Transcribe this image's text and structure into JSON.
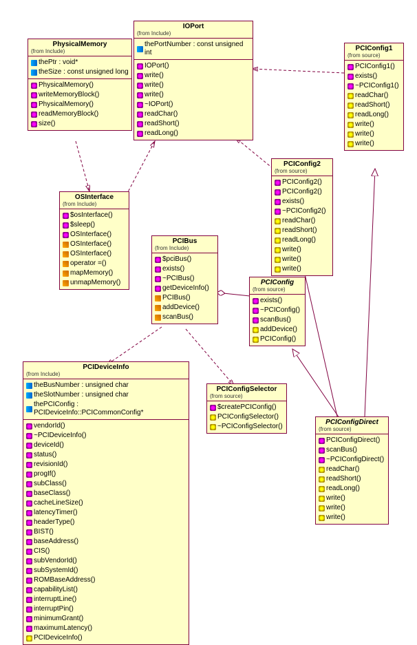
{
  "classes": {
    "PhysicalMemory": {
      "name": "PhysicalMemory",
      "from": "(from Include)",
      "attrs": [
        {
          "v": "attr",
          "t": "thePtr : void*"
        },
        {
          "v": "attr",
          "t": "theSize : const unsigned long"
        }
      ],
      "ops": [
        {
          "v": "pub",
          "t": "PhysicalMemory()"
        },
        {
          "v": "pub",
          "t": "writeMemoryBlock()"
        },
        {
          "v": "pub",
          "t": "PhysicalMemory()"
        },
        {
          "v": "pub",
          "t": "readMemoryBlock()"
        },
        {
          "v": "pub",
          "t": "size()"
        }
      ]
    },
    "IOPort": {
      "name": "IOPort",
      "from": "(from Include)",
      "attrs": [
        {
          "v": "attr",
          "t": "thePortNumber : const unsigned int"
        }
      ],
      "ops": [
        {
          "v": "pub",
          "t": "IOPort()"
        },
        {
          "v": "pub",
          "t": "write()"
        },
        {
          "v": "pub",
          "t": "write()"
        },
        {
          "v": "pub",
          "t": "write()"
        },
        {
          "v": "pub",
          "t": "~IOPort()"
        },
        {
          "v": "pub",
          "t": "readChar()"
        },
        {
          "v": "pub",
          "t": "readShort()"
        },
        {
          "v": "pub",
          "t": "readLong()"
        }
      ]
    },
    "PCIConfig1": {
      "name": "PCIConfig1",
      "from": "(from source)",
      "ops": [
        {
          "v": "pub",
          "t": "PCIConfig1()"
        },
        {
          "v": "pub",
          "t": "exists()"
        },
        {
          "v": "pub",
          "t": "~PCIConfig1()"
        },
        {
          "v": "prot",
          "t": "readChar()"
        },
        {
          "v": "prot",
          "t": "readShort()"
        },
        {
          "v": "prot",
          "t": "readLong()"
        },
        {
          "v": "prot",
          "t": "write()"
        },
        {
          "v": "prot",
          "t": "write()"
        },
        {
          "v": "prot",
          "t": "write()"
        }
      ]
    },
    "PCIConfig2": {
      "name": "PCIConfig2",
      "from": "(from source)",
      "ops": [
        {
          "v": "pub",
          "t": "PCIConfig2()"
        },
        {
          "v": "pub",
          "t": "PCIConfig2()"
        },
        {
          "v": "pub",
          "t": "exists()"
        },
        {
          "v": "pub",
          "t": "~PCIConfig2()"
        },
        {
          "v": "prot",
          "t": "readChar()"
        },
        {
          "v": "prot",
          "t": "readShort()"
        },
        {
          "v": "prot",
          "t": "readLong()"
        },
        {
          "v": "prot",
          "t": "write()"
        },
        {
          "v": "prot",
          "t": "write()"
        },
        {
          "v": "prot",
          "t": "write()"
        }
      ]
    },
    "OSInterface": {
      "name": "OSInterface",
      "from": "(from Include)",
      "ops": [
        {
          "v": "pub",
          "t": "$osInterface()"
        },
        {
          "v": "pub",
          "t": "$sleep()"
        },
        {
          "v": "pub",
          "t": "OSInterface()"
        },
        {
          "v": "priv",
          "t": "OSInterface()"
        },
        {
          "v": "priv",
          "t": "OSInterface()"
        },
        {
          "v": "priv",
          "t": "operator =()"
        },
        {
          "v": "priv",
          "t": "mapMemory()"
        },
        {
          "v": "priv",
          "t": "unmapMemory()"
        }
      ]
    },
    "PCIBus": {
      "name": "PCIBus",
      "from": "(from Include)",
      "ops": [
        {
          "v": "pub",
          "t": "$pciBus()"
        },
        {
          "v": "pub",
          "t": "exists()"
        },
        {
          "v": "pub",
          "t": "~PCIBus()"
        },
        {
          "v": "pub",
          "t": "getDeviceInfo()"
        },
        {
          "v": "priv",
          "t": "PCIBus()"
        },
        {
          "v": "priv",
          "t": "addDevice()"
        },
        {
          "v": "priv",
          "t": "scanBus()"
        }
      ]
    },
    "PCIConfig": {
      "name": "PCIConfig",
      "from": "(from source)",
      "italic": true,
      "ops": [
        {
          "v": "pub",
          "t": "exists()"
        },
        {
          "v": "pub",
          "t": "~PCIConfig()"
        },
        {
          "v": "pub",
          "t": "scanBus()"
        },
        {
          "v": "prot",
          "t": "addDevice()"
        },
        {
          "v": "prot",
          "t": "PCIConfig()"
        }
      ]
    },
    "PCIDeviceInfo": {
      "name": "PCIDeviceInfo",
      "from": "(from Include)",
      "attrs": [
        {
          "v": "attr",
          "t": "theBusNumber : unsigned char"
        },
        {
          "v": "attr",
          "t": "theSlotNumber : unsigned char"
        },
        {
          "v": "attr",
          "t": "thePCIConfig : PCIDeviceInfo::PCICommonConfig*"
        }
      ],
      "ops": [
        {
          "v": "pub",
          "t": "vendorId()"
        },
        {
          "v": "pub",
          "t": "~PCIDeviceInfo()"
        },
        {
          "v": "pub",
          "t": "deviceId()"
        },
        {
          "v": "pub",
          "t": "status()"
        },
        {
          "v": "pub",
          "t": "revisionId()"
        },
        {
          "v": "pub",
          "t": "progIf()"
        },
        {
          "v": "pub",
          "t": "subClass()"
        },
        {
          "v": "pub",
          "t": "baseClass()"
        },
        {
          "v": "pub",
          "t": "cacheLineSize()"
        },
        {
          "v": "pub",
          "t": "latencyTimer()"
        },
        {
          "v": "pub",
          "t": "headerType()"
        },
        {
          "v": "pub",
          "t": "BIST()"
        },
        {
          "v": "pub",
          "t": "baseAddress()"
        },
        {
          "v": "pub",
          "t": "CIS()"
        },
        {
          "v": "pub",
          "t": "subVendorId()"
        },
        {
          "v": "pub",
          "t": "subSystemId()"
        },
        {
          "v": "pub",
          "t": "ROMBaseAddress()"
        },
        {
          "v": "pub",
          "t": "capabilityList()"
        },
        {
          "v": "pub",
          "t": "interruptLine()"
        },
        {
          "v": "pub",
          "t": "interruptPin()"
        },
        {
          "v": "pub",
          "t": "minimumGrant()"
        },
        {
          "v": "pub",
          "t": "maximumLatency()"
        },
        {
          "v": "prot",
          "t": "PCIDeviceInfo()"
        }
      ]
    },
    "PCIConfigSelector": {
      "name": "PCIConfigSelector",
      "from": "(from source)",
      "ops": [
        {
          "v": "pub",
          "t": "$createPCIConfig()"
        },
        {
          "v": "prot",
          "t": "PCIConfigSelector()"
        },
        {
          "v": "prot",
          "t": "~PCIConfigSelector()"
        }
      ]
    },
    "PCIConfigDirect": {
      "name": "PCIConfigDirect",
      "from": "(from source)",
      "italic": true,
      "ops": [
        {
          "v": "pub",
          "t": "PCIConfigDirect()"
        },
        {
          "v": "pub",
          "t": "scanBus()"
        },
        {
          "v": "pub",
          "t": "~PCIConfigDirect()"
        },
        {
          "v": "prot",
          "t": "readChar()"
        },
        {
          "v": "prot",
          "t": "readShort()"
        },
        {
          "v": "prot",
          "t": "readLong()"
        },
        {
          "v": "prot",
          "t": "write()"
        },
        {
          "v": "prot",
          "t": "write()"
        },
        {
          "v": "prot",
          "t": "write()"
        }
      ]
    }
  }
}
